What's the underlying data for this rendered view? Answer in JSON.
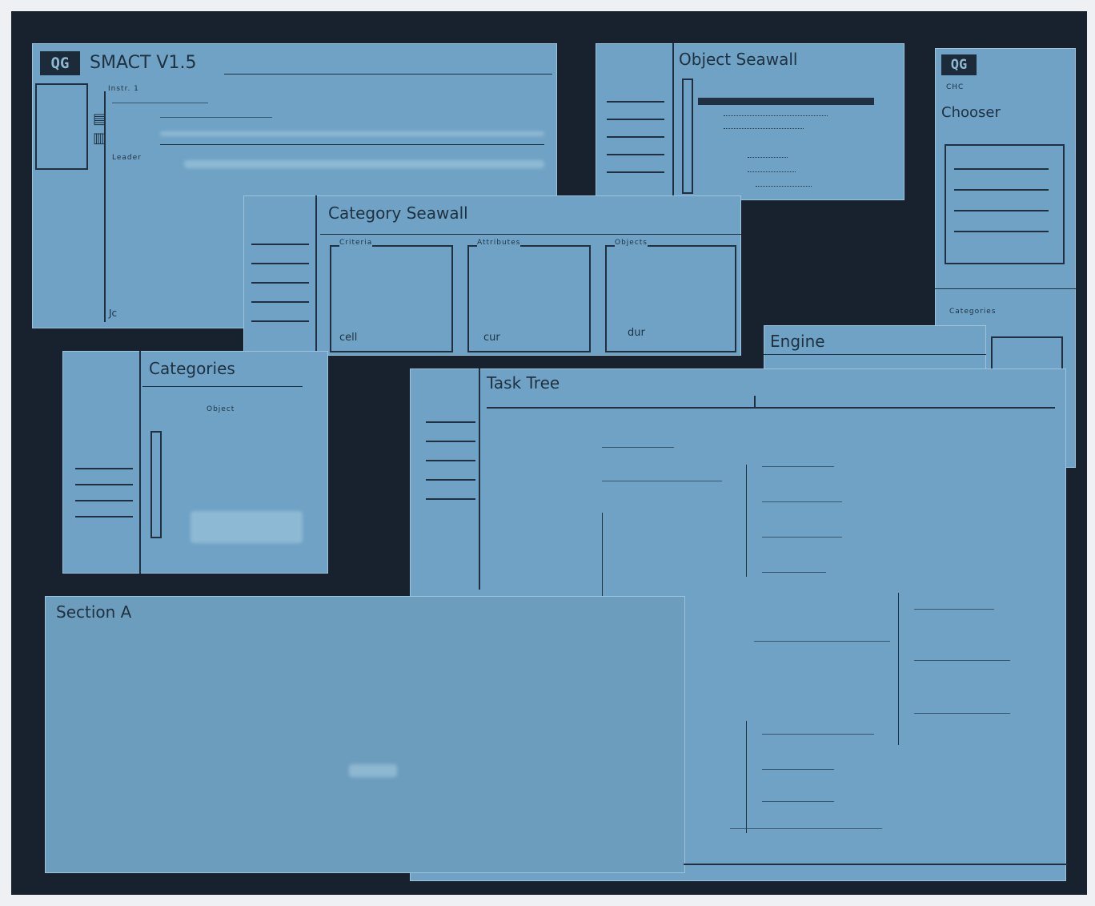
{
  "main_window": {
    "logo": "QG",
    "title": "SMACT V1.5",
    "menu_item": "Instr. 1",
    "status": "Leader",
    "mark": "Jc"
  },
  "object_window": {
    "title": "Object Seawall"
  },
  "chooser_window": {
    "logo": "QG",
    "title": "Chooser",
    "subtitle": "CHC",
    "footer": "Categories"
  },
  "category_window": {
    "title": "Category Seawall",
    "panels": [
      "Criteria",
      "Attributes",
      "Objects"
    ],
    "labels": [
      "cell",
      "cur",
      "dur"
    ]
  },
  "categories_window": {
    "title": "Categories",
    "header": "Object"
  },
  "task_tree_window": {
    "title": "Task Tree"
  },
  "engine_window": {
    "title": "Engine"
  },
  "section_window": {
    "title": "Section A"
  }
}
